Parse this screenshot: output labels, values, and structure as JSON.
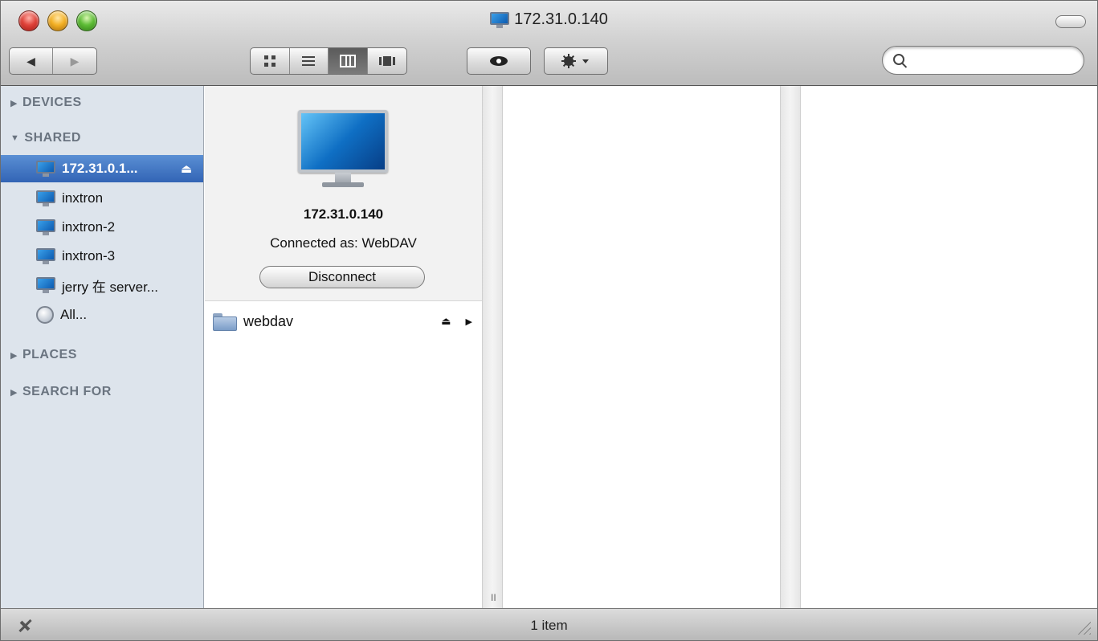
{
  "window": {
    "title": "172.31.0.140"
  },
  "toolbar": {
    "back_glyph": "◀",
    "forward_glyph": "▶",
    "view_icons": [
      "icon-view-icon",
      "list-view-icon",
      "column-view-icon",
      "coverflow-view-icon"
    ],
    "quicklook_glyph": "●",
    "action_glyph": "✲▾",
    "search_placeholder": ""
  },
  "sidebar": {
    "devices_label": "DEVICES",
    "shared_label": "SHARED",
    "places_label": "PLACES",
    "search_for_label": "SEARCH FOR",
    "shared_items": [
      {
        "label": "172.31.0.1...",
        "selected": true,
        "icon": "computer-icon"
      },
      {
        "label": "inxtron",
        "icon": "computer-icon"
      },
      {
        "label": "inxtron-2",
        "icon": "computer-icon"
      },
      {
        "label": "inxtron-3",
        "icon": "computer-icon"
      },
      {
        "label": "jerry 在 server...",
        "icon": "computer-icon"
      },
      {
        "label": "All...",
        "icon": "network-globe-icon"
      }
    ]
  },
  "preview": {
    "name": "172.31.0.140",
    "connected_as": "Connected as: WebDAV",
    "disconnect_label": "Disconnect"
  },
  "column1": {
    "items": [
      {
        "label": "webdav",
        "icon": "shared-folder-icon"
      }
    ]
  },
  "status": {
    "text": "1 item"
  },
  "colors": {
    "selection": "#3264b5",
    "sidebar_bg": "#dde4ec"
  }
}
